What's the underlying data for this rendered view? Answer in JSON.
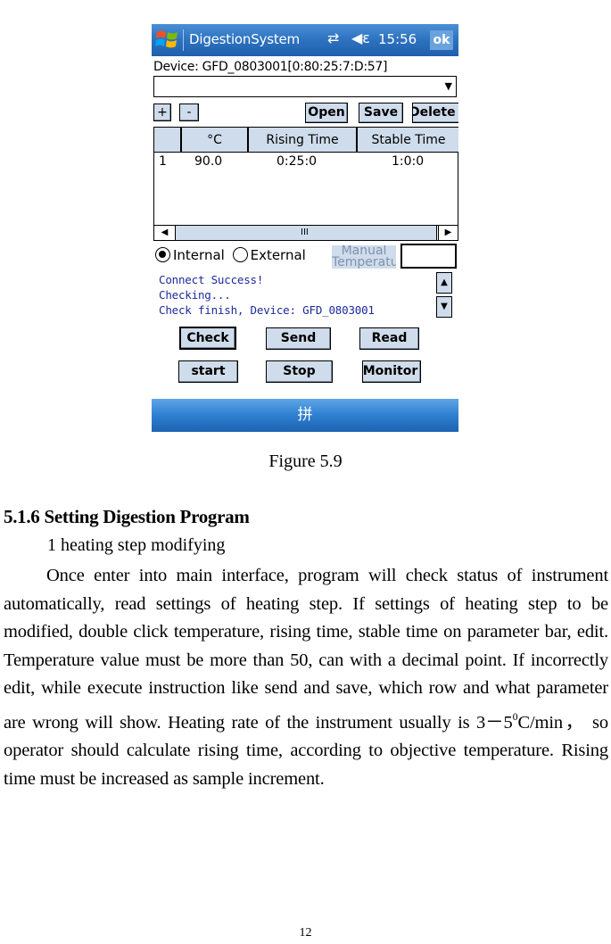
{
  "figure": {
    "titlebar": {
      "app_title": "DigestionSystem",
      "connection_icon": "⇄",
      "volume_icon": "◀ε",
      "clock": "15:56",
      "ok_label": "ok"
    },
    "device_label": "Device: GFD_0803001[0:80:25:7:D:57]",
    "device_select": {
      "value": "",
      "arrow": "▼"
    },
    "toolbar": {
      "add_label": "+",
      "remove_label": "-",
      "open_label": "Open",
      "save_label": "Save",
      "delete_label": "Delete"
    },
    "grid": {
      "columns": [
        "",
        "°C",
        "Rising Time",
        "Stable Time"
      ],
      "rows": [
        {
          "index": "1",
          "temperature": "90.0",
          "rising_time": "0:25:0",
          "stable_time": "1:0:0"
        }
      ]
    },
    "hscroll": {
      "left_arrow": "◀",
      "thumb": "III",
      "right_arrow": "▶"
    },
    "sensor": {
      "internal_label": "Internal",
      "internal_selected": true,
      "external_label": "External",
      "external_selected": false,
      "manual_label": "Manual Temperature",
      "manual_value": ""
    },
    "log_lines": [
      "Connect Success!",
      "Checking...",
      "Check finish, Device: GFD_0803001"
    ],
    "vscroll": {
      "up_arrow": "▲",
      "down_arrow": "▼"
    },
    "buttons": {
      "check": "Check",
      "send": "Send",
      "read": "Read",
      "start": "start",
      "stop": "Stop",
      "monitor": "Monitor"
    },
    "softbar": {
      "input_method": "拼"
    }
  },
  "caption": "Figure 5.9",
  "section_heading": "5.1.6 Setting Digestion Program",
  "subheading": "1 heating step modifying",
  "paragraph": {
    "part1": "Once enter into main interface, program will check status of instrument automatically, read settings of heating step. If settings of heating step to be modified, double click temperature, rising time, stable time on parameter bar, edit. Temperature value must be more than 50, can with a decimal point. If incorrectly edit, while execute instruction like send and save, which row and what parameter are wrong will show. Heating rate of the instrument usually is 3－5",
    "superscript": "0",
    "part2": "C/min， so operator should calculate rising time, according to objective temperature. Rising time must be increased as sample increment."
  },
  "page_number": "12"
}
